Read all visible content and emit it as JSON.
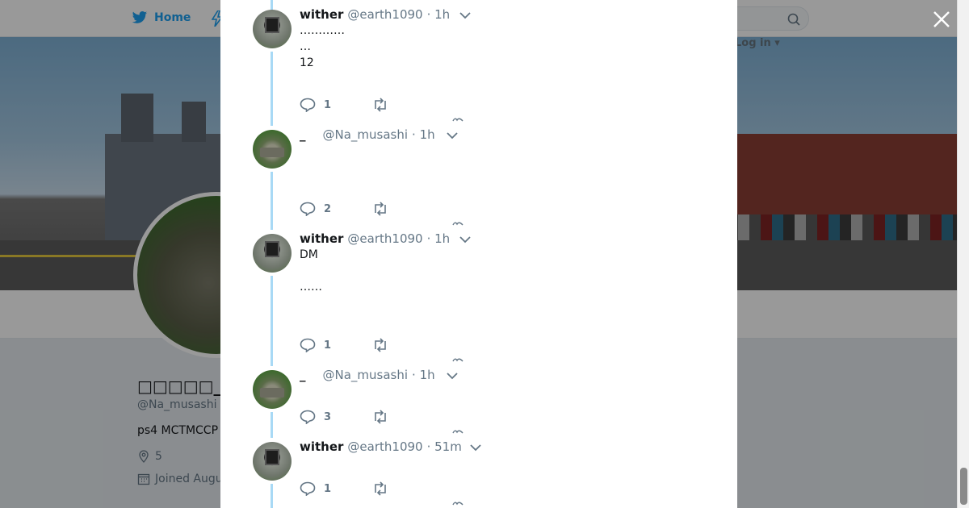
{
  "nav": {
    "home_label": "Home",
    "login_label": "Log in ▾"
  },
  "profile": {
    "name": "□□□□□_□□□",
    "handle": "@Na_musashi",
    "bio": "ps4 MCTMCCP",
    "location": "5",
    "joined": "Joined Augu"
  },
  "tweets": [
    {
      "author": "wither",
      "handle": "@earth1090",
      "time": "· 1h",
      "text": "…………\n…\n12",
      "replies": "1",
      "avatar": "wither-avatar"
    },
    {
      "author": "_",
      "handle": "@Na_musashi",
      "time": "· 1h",
      "text": "",
      "replies": "2",
      "avatar": "tank-avatar"
    },
    {
      "author": "wither",
      "handle": "@earth1090",
      "time": "· 1h",
      "text": "DM\n\n……",
      "replies": "1",
      "avatar": "wither-avatar"
    },
    {
      "author": "_",
      "handle": "@Na_musashi",
      "time": "· 1h",
      "text": "",
      "replies": "3",
      "avatar": "tank-avatar"
    },
    {
      "author": "wither",
      "handle": "@earth1090",
      "time": "· 51m",
      "text": "",
      "replies": "1",
      "avatar": "wither-avatar"
    }
  ],
  "colors": {
    "accent": "#1da1f2",
    "thread_line": "#a8d9f5",
    "muted": "#657786"
  }
}
